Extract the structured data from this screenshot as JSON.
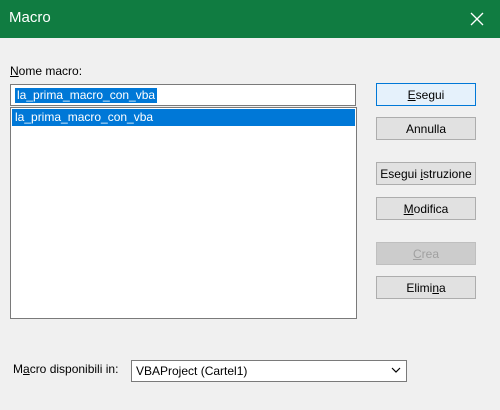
{
  "window": {
    "title": "Macro",
    "close_icon": "close-icon"
  },
  "macro_name": {
    "label": "Nome macro:",
    "label_accel": "N",
    "label_rest": "ome macro:",
    "value": "la_prima_macro_con_vba"
  },
  "macro_list": {
    "items": [
      "la_prima_macro_con_vba"
    ],
    "selected_index": 0
  },
  "buttons": {
    "run": {
      "label": "Esegui",
      "accel": "E",
      "rest": "segui"
    },
    "cancel": {
      "label": "Annulla"
    },
    "step_into": {
      "label": "Esegui istruzione",
      "pre": "Esegui ",
      "accel": "i",
      "rest": "struzione"
    },
    "edit": {
      "label": "Modifica",
      "accel": "M",
      "rest": "odifica"
    },
    "create": {
      "label": "Crea",
      "accel": "C",
      "rest": "rea"
    },
    "delete": {
      "label": "Elimina",
      "pre": "Elimi",
      "accel": "n",
      "rest": "a"
    }
  },
  "macros_in": {
    "label": "Macro disponibili in:",
    "pre": "M",
    "accel": "a",
    "rest": "cro disponibili in:",
    "selected_value": "VBAProject (Cartel1)",
    "dropdown_icon": "chevron-down-icon"
  },
  "colors": {
    "titlebar": "#107c41",
    "selection": "#0078d7",
    "dialog_bg": "#f0f0f0"
  }
}
